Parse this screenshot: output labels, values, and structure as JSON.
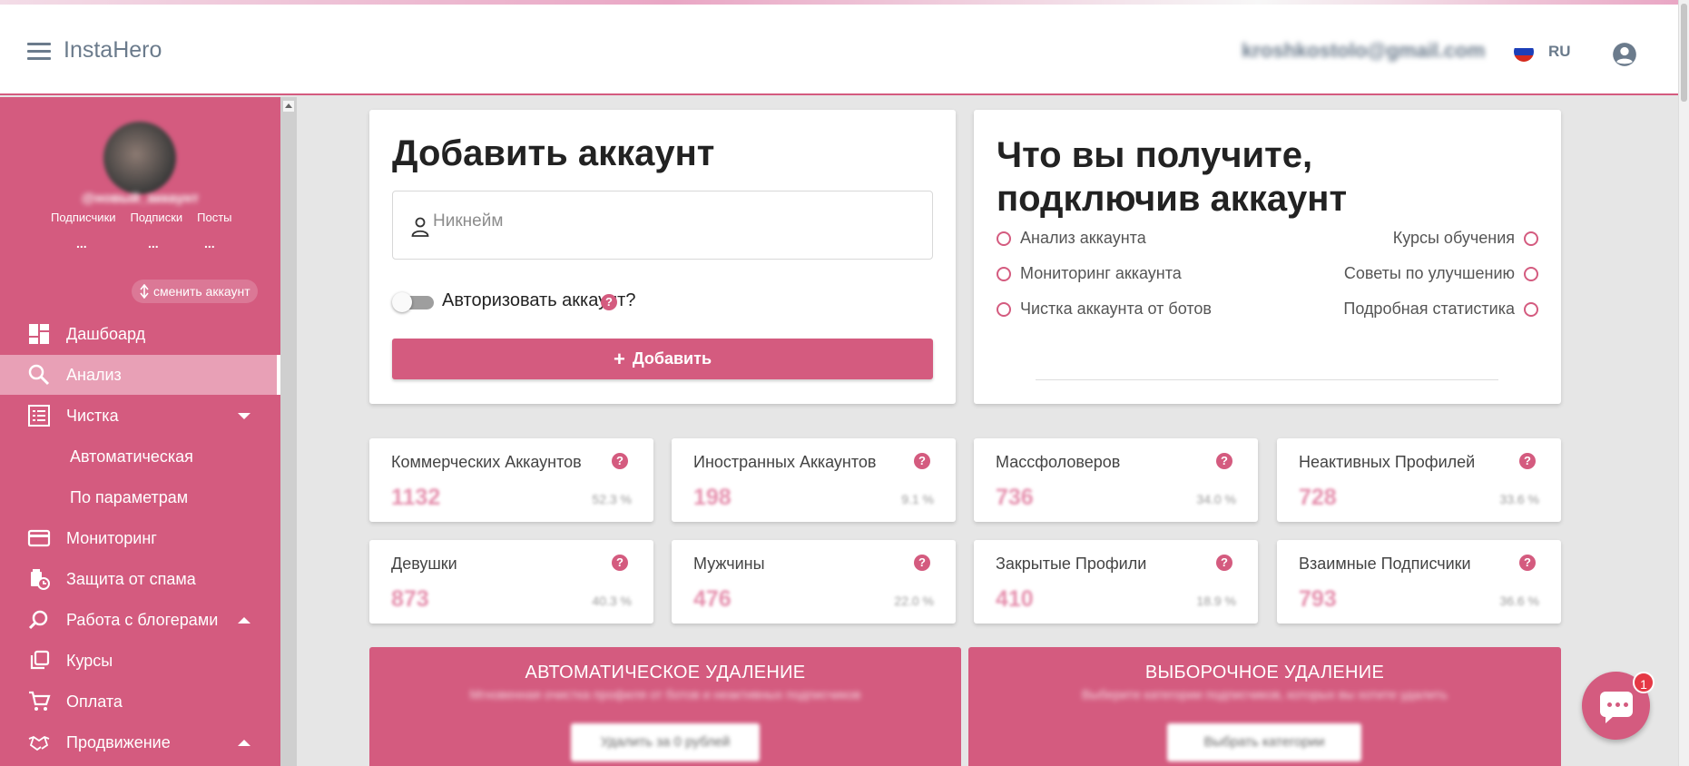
{
  "header": {
    "brand": "InstaHero",
    "email": "kroshkostolo@gmail.com",
    "lang": "RU"
  },
  "sidebar": {
    "username": "@новый_аккаунт",
    "stat_labels": [
      "Подписчики",
      "Подписки",
      "Посты"
    ],
    "stat_values": [
      "...",
      "...",
      "..."
    ],
    "switch_label": "сменить аккаунт",
    "items": [
      {
        "label": "Дашбоард",
        "icon": "dashboard-icon"
      },
      {
        "label": "Анализ",
        "icon": "search-icon",
        "active": true
      },
      {
        "label": "Чистка",
        "icon": "list-icon"
      },
      {
        "label": "Автоматическая"
      },
      {
        "label": "По параметрам"
      },
      {
        "label": "Мониторинг",
        "icon": "card-icon"
      },
      {
        "label": "Защита от спама",
        "icon": "spam-protection-icon"
      },
      {
        "label": "Работа с блогерами",
        "icon": "blogger-search-icon"
      },
      {
        "label": "Курсы",
        "icon": "courses-icon"
      },
      {
        "label": "Оплата",
        "icon": "cart-icon"
      },
      {
        "label": "Продвижение",
        "icon": "handshake-icon"
      }
    ]
  },
  "add_account": {
    "title": "Добавить аккаунт",
    "nickname_placeholder": "Никнейм",
    "nickname_value": "",
    "authorize_label": "Авторизовать аккаунт?",
    "authorize_enabled": false,
    "add_button": "Добавить"
  },
  "benefits": {
    "title": "Что вы получите, подключив аккаунт",
    "left": [
      "Анализ аккаунта",
      "Мониторинг аккаунта",
      "Чистка аккаунта от ботов"
    ],
    "right": [
      "Курсы обучения",
      "Советы по улучшению",
      "Подробная статистика"
    ]
  },
  "stats": [
    {
      "label": "Коммерческих Аккаунтов",
      "value": "1132",
      "percent": "52.3 %"
    },
    {
      "label": "Иностранных Аккаунтов",
      "value": "198",
      "percent": "9.1 %"
    },
    {
      "label": "Массфоловеров",
      "value": "736",
      "percent": "34.0 %"
    },
    {
      "label": "Неактивных Профилей",
      "value": "728",
      "percent": "33.6 %"
    },
    {
      "label": "Девушки",
      "value": "873",
      "percent": "40.3 %"
    },
    {
      "label": "Мужчины",
      "value": "476",
      "percent": "22.0 %"
    },
    {
      "label": "Закрытые Профили",
      "value": "410",
      "percent": "18.9 %"
    },
    {
      "label": "Взаимные Подписчики",
      "value": "793",
      "percent": "36.6 %"
    }
  ],
  "actions": {
    "auto": {
      "title": "АВТОМАТИЧЕСКОЕ УДАЛЕНИЕ",
      "subtitle": "Мгновенная очистка профиля от ботов и неактивных подписчиков",
      "button": "Удалить за 0 рублей"
    },
    "selective": {
      "title": "ВЫБОРОЧНОЕ УДАЛЕНИЕ",
      "subtitle": "Выберите категории подписчиков, которых вы хотите удалить",
      "button": "Выбрать категории"
    }
  },
  "chat": {
    "badge": "1"
  },
  "colors": {
    "accent": "#d45b7f",
    "accent_light": "#e8a0b6",
    "number": "#e58fad"
  }
}
